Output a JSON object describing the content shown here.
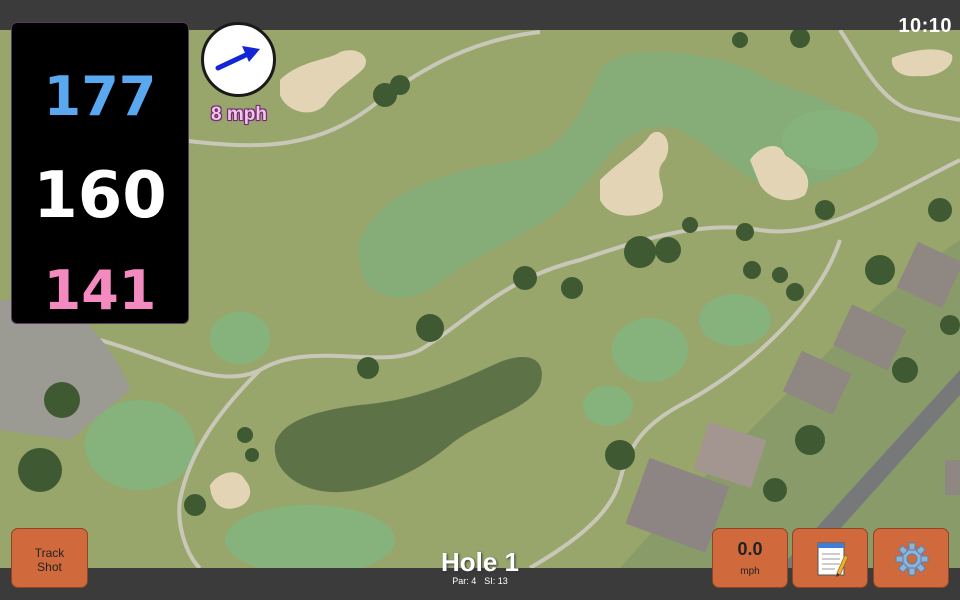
{
  "status_bar": {
    "clock": "10:10"
  },
  "distances": {
    "back": "177",
    "middle": "160",
    "front": "141"
  },
  "wind": {
    "speed": "8 mph",
    "icon": "arrow-right-icon"
  },
  "hole": {
    "title": "Hole 1",
    "par": "Par: 4",
    "stroke_index": "SI: 13"
  },
  "toolbar": {
    "track_shot_line1": "Track",
    "track_shot_line2": "Shot",
    "speed_value": "0.0",
    "speed_unit": "mph",
    "notes_icon": "notepad-icon",
    "settings_icon": "gear-icon"
  },
  "colors": {
    "back_distance": "#5aa9f0",
    "middle_distance": "#ffffff",
    "front_distance": "#f48bc0",
    "button": "#d06a3c",
    "wind_text": "#f0c6ea"
  }
}
